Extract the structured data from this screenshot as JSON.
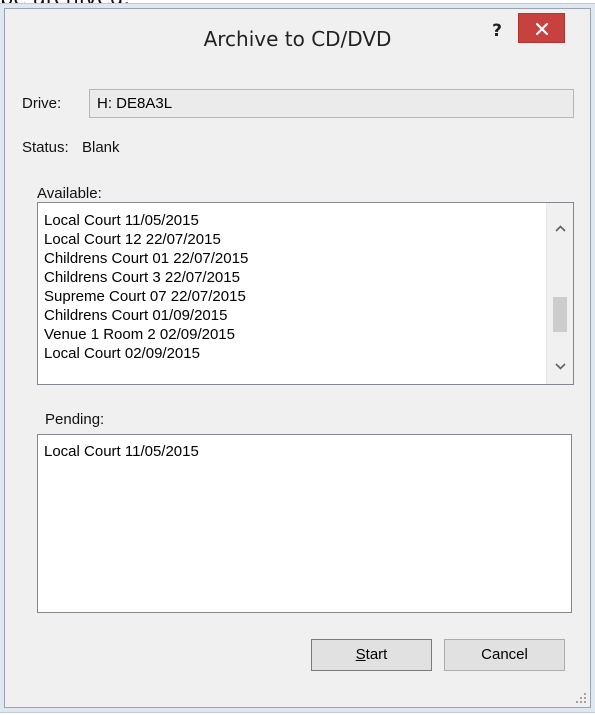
{
  "background": {
    "partial_text": "be archived."
  },
  "dialog": {
    "title": "Archive to CD/DVD",
    "help_glyph": "?",
    "drive_label": "Drive:",
    "drive_value": "H: DE8A3L",
    "status_label": "Status:",
    "status_value": "Blank",
    "available_label": "Available:",
    "available_items": [
      "Local Court  11/05/2015",
      "Local Court 12 22/07/2015",
      "Childrens Court 01 22/07/2015",
      "Childrens Court 3 22/07/2015",
      "Supreme Court 07 22/07/2015",
      "Childrens Court 01/09/2015",
      "Venue 1 Room 2 02/09/2015",
      "Local Court  02/09/2015"
    ],
    "pending_label": "Pending:",
    "pending_items": [
      "Local Court  11/05/2015"
    ],
    "start_label": "Start",
    "start_accel": "S",
    "start_rest": "tart",
    "cancel_label": "Cancel"
  },
  "colors": {
    "close_button": "#c7413f",
    "window_bg": "#f0f0f0",
    "scroll_thumb": "#cdcdcd"
  },
  "icons": {
    "close": "close-icon",
    "scroll_up": "chevron-up-icon",
    "scroll_down": "chevron-down-icon",
    "grip": "resize-grip-icon"
  }
}
